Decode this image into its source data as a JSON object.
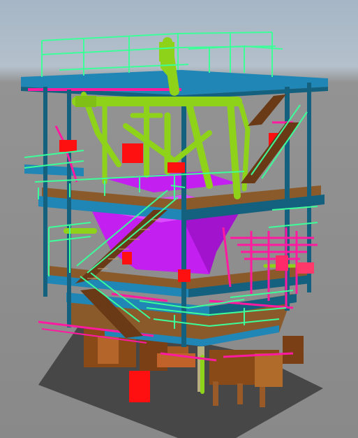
{
  "viewport": {
    "scene": "offshore-module-3d-model",
    "colors": {
      "sky_top": "#a6b6c6",
      "sky_horizon": "#b4c0cb",
      "ground": "#8c8c8c",
      "ground_shadow": "#474747",
      "steel_beam": "#1f86b5",
      "steel_beam_dark": "#14607f",
      "deck_plate": "#8b5a2b",
      "handrail": "#3cff9a",
      "piping_lime": "#8fd21a",
      "piping_magenta": "#ff1aa0",
      "vessel_violet": "#c21ff0",
      "equipment_red": "#ff1010",
      "equipment_brown": "#9a4f1a"
    }
  }
}
